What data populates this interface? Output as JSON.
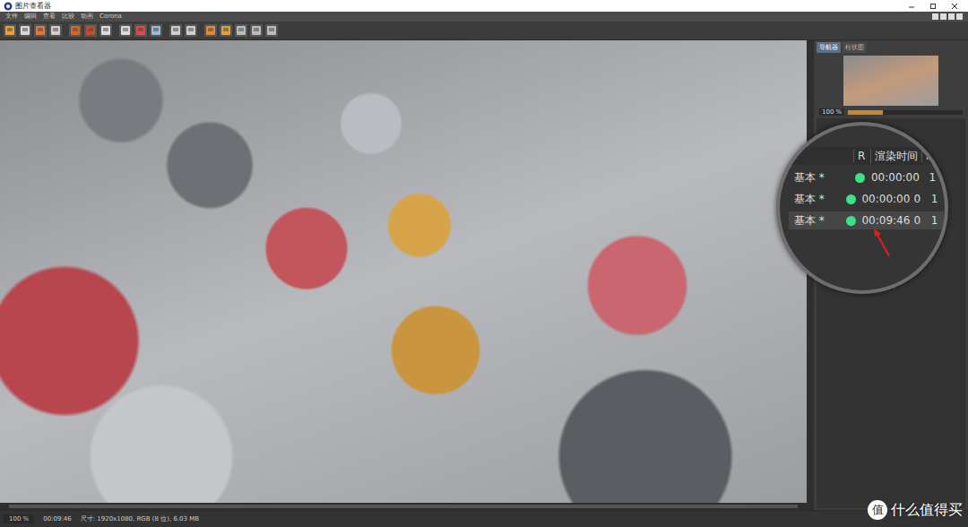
{
  "window": {
    "title": "图片查看器"
  },
  "menu": [
    "文件",
    "编辑",
    "查看",
    "比较",
    "动画",
    "Corona"
  ],
  "sidebar": {
    "tabs": [
      {
        "label": "导航器",
        "selected": true
      },
      {
        "label": "柱状图",
        "selected": false
      }
    ],
    "zoom": "100 %",
    "zoom_level": 0.3
  },
  "history": {
    "columns": [
      "R",
      "渲染时间",
      "F"
    ],
    "rows": [
      {
        "name": "基本 *",
        "color": "#3fe08a",
        "time": "00:00:00",
        "cells": [
          "1"
        ],
        "selected": false
      },
      {
        "name": "基本 *",
        "color": "#3fe08a",
        "time": "00:00:00",
        "cells": [
          "0",
          "1"
        ],
        "selected": false
      },
      {
        "name": "基本 *",
        "color": "#3fe08a",
        "time": "00:09:46",
        "cells": [
          "0",
          "1"
        ],
        "selected": true
      }
    ]
  },
  "status_bar": {
    "zoom": "100 %",
    "time": "00:09:46",
    "info": "尺寸: 1920x1080, RGB (8 位), 6.03 MB"
  },
  "watermark": {
    "logo": "值",
    "text": "什么值得买"
  }
}
